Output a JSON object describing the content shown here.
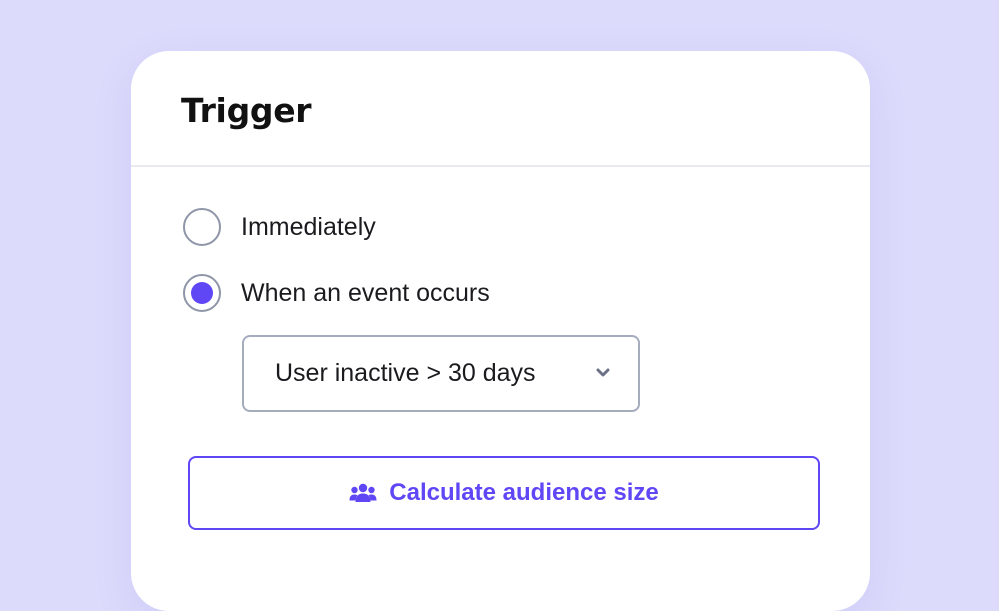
{
  "card": {
    "title": "Trigger"
  },
  "trigger_options": [
    {
      "label": "Immediately",
      "selected": false
    },
    {
      "label": "When an event occurs",
      "selected": true
    }
  ],
  "event_select": {
    "value": "User inactive > 30 days",
    "icon": "chevron-down-icon"
  },
  "calculate_button": {
    "label": "Calculate audience size",
    "icon": "users-icon"
  },
  "colors": {
    "accent": "#6047f5",
    "background": "#dcdbfc",
    "card": "#ffffff",
    "border": "#a4acbd"
  }
}
